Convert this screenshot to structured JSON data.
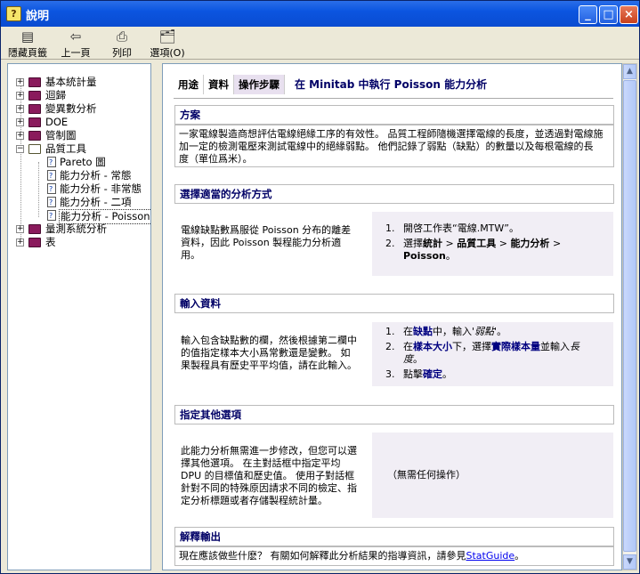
{
  "window": {
    "title": "說明",
    "app_icon": "?"
  },
  "toolbar": {
    "hide_tabs": "隱藏頁籤",
    "back": "上一頁",
    "print": "列印",
    "options": "選項(O)"
  },
  "nav": {
    "items": [
      {
        "label": "基本統計量"
      },
      {
        "label": "迴歸"
      },
      {
        "label": "變異數分析"
      },
      {
        "label": "DOE"
      },
      {
        "label": "管制圖"
      },
      {
        "label": "品質工具"
      },
      {
        "label": "Pareto 圖"
      },
      {
        "label": "能力分析 - 常態"
      },
      {
        "label": "能力分析 - 非常態"
      },
      {
        "label": "能力分析 - 二項"
      },
      {
        "label": "能力分析 - Poisson"
      },
      {
        "label": "量測系統分析"
      },
      {
        "label": "表"
      }
    ],
    "expanded_mark": "−",
    "collapsed_mark": "+"
  },
  "content": {
    "tabs": [
      {
        "label": "用途"
      },
      {
        "label": "資料"
      },
      {
        "label": "操作步驟"
      }
    ],
    "title": "在 Minitab 中執行 Poisson 能力分析",
    "sections": {
      "case": {
        "heading": "方案",
        "left": "一家電線製造商想評估電線絕緣工序的有效性。品質工程師隨機選擇電線的長度，並透過對電線施加一定的檢測電壓來測試電線中的絕緣弱點。他們記錄了弱點（缺點）的數量以及每根電線的長度（單位爲米）。",
        "line1": "一家電線製造商想評估電線絕緣工序的有效性。 品質工程師隨機選擇電線的長度，並透過對電線施",
        "line2": "加一定的檢測電壓來測試電線中的絕緣弱點。 他們記錄了弱點（缺點）的數量以及每根電線的長",
        "line3": "度（單位爲米）。"
      },
      "method": {
        "heading": "選擇適當的分析方式",
        "left_l1": "電線缺點數爲服從 Poisson 分布的離差",
        "left_l2": "資料，因此 Poisson 製程能力分析適",
        "left_l3": "用。",
        "step1_n": "1.",
        "step1": "開啓工作表“電線.MTW”。",
        "step2_n": "2.",
        "step2_pre": "選擇",
        "step2_a": "統計",
        "step2_b": "品質工具",
        "step2_c": "能力分析",
        "step2_d": "Poisson",
        "sep": ">",
        "end": "。"
      },
      "input": {
        "heading": "輸入資料",
        "left_l1": "輸入包含缺點數的欄，然後根據第二欄中",
        "left_l2": "的值指定樣本大小爲常數還是變數。 如",
        "left_l3": "果製程具有歷史平平均值，請在此輸入。",
        "s1_n": "1.",
        "s1_pre": "在",
        "s1_field": "缺點",
        "s1_mid": "中，輸入",
        "s1_val": "'弱點'",
        "s1_end": "。",
        "s2_n": "2.",
        "s2_pre": "在",
        "s2_field": "樣本大小",
        "s2_mid": "下，選擇",
        "s2_opt": "實際樣本量",
        "s2_mid2": "並輸入",
        "s2_val": "長",
        "s2_val2": "度",
        "s2_end": "。",
        "s3_n": "3.",
        "s3_pre": "點擊",
        "s3_btn": "確定",
        "s3_end": "。"
      },
      "other": {
        "heading": "指定其他選項",
        "left_l1": "此能力分析無需進一步修改，但您可以選",
        "left_l2": "擇其他選項。 在主對話框中指定平均",
        "left_l3": "DPU 的目標值和歷史值。 使用子對話框",
        "left_l4": "針對不同的特殊原因請求不同的檢定、指",
        "left_l5": "定分析標題或者存儲製程統計量。",
        "right": "（無需任何操作）"
      },
      "interpret": {
        "heading": "解釋輸出",
        "text": "現在應該做些什麽？ 有關如何解釋此分析結果的指導資訊，請參見",
        "link": "StatGuide",
        "end": "。"
      }
    }
  },
  "colors": {
    "titlebar": "#0b55e0",
    "heading_text": "#000066",
    "gray_box": "#f1eef5",
    "link": "#0000ee"
  }
}
